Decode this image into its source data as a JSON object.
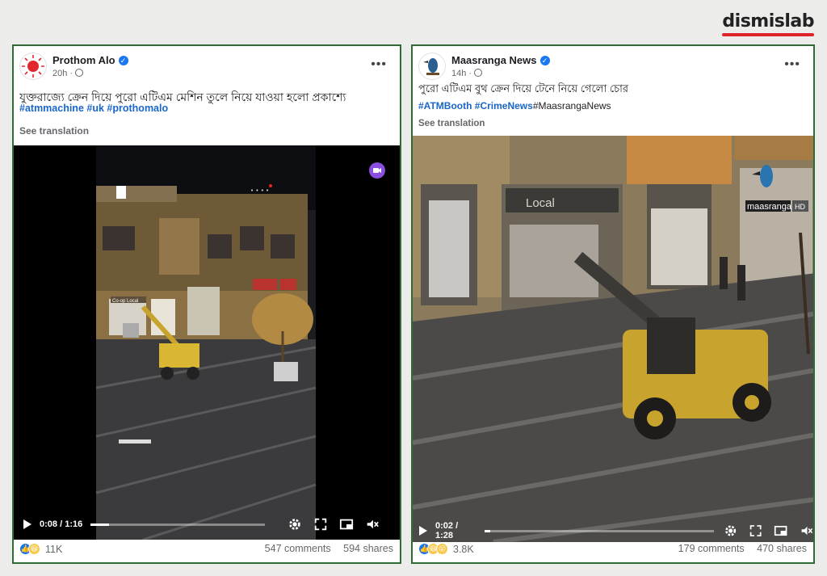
{
  "brand": {
    "name": "dismislab"
  },
  "post1": {
    "page_name": "Prothom Alo",
    "time": "20h ·",
    "caption": "যুক্তরাজ্যে ক্রেন দিয়ে পুরো এটিএম মেশিন তুলে নিয়ে যাওয়া হলো প্রকাশ্যে",
    "hashtags": [
      "#atmmachine",
      "#uk",
      "#prothomalo"
    ],
    "see_translation": "See translation",
    "video": {
      "current": "0:08",
      "total": "1:16",
      "progress": 0.105,
      "store_sign": "Co-op Local"
    },
    "reactions_count": "11K",
    "comments": "547 comments",
    "shares": "594 shares"
  },
  "post2": {
    "page_name": "Maasranga News",
    "time": "14h ·",
    "caption": "পুরো এটিএম বুথ ক্রেন দিয়ে টেনে নিয়ে গেলো চোর",
    "hashtags": [
      "#ATMBooth",
      "#CrimeNews"
    ],
    "hashtag_plain": "#MaasrangaNews",
    "see_translation": "See translation",
    "video": {
      "current": "0:02",
      "total": "1:28",
      "progress": 0.023,
      "store_sign": "Local",
      "watermark": "maasranga",
      "watermark_badge": "HD"
    },
    "reactions_count": "3.8K",
    "comments": "179 comments",
    "shares": "470 shares"
  },
  "icons": [
    "more-icon",
    "verified-icon",
    "globe-icon",
    "play-icon",
    "settings-icon",
    "fullscreen-icon",
    "pip-icon",
    "mute-icon",
    "like-icon",
    "haha-icon",
    "wow-icon"
  ],
  "colors": {
    "border": "#2f6b34",
    "link": "#1a66c9",
    "verified": "#1877f2",
    "brand_red": "#e0232b"
  }
}
